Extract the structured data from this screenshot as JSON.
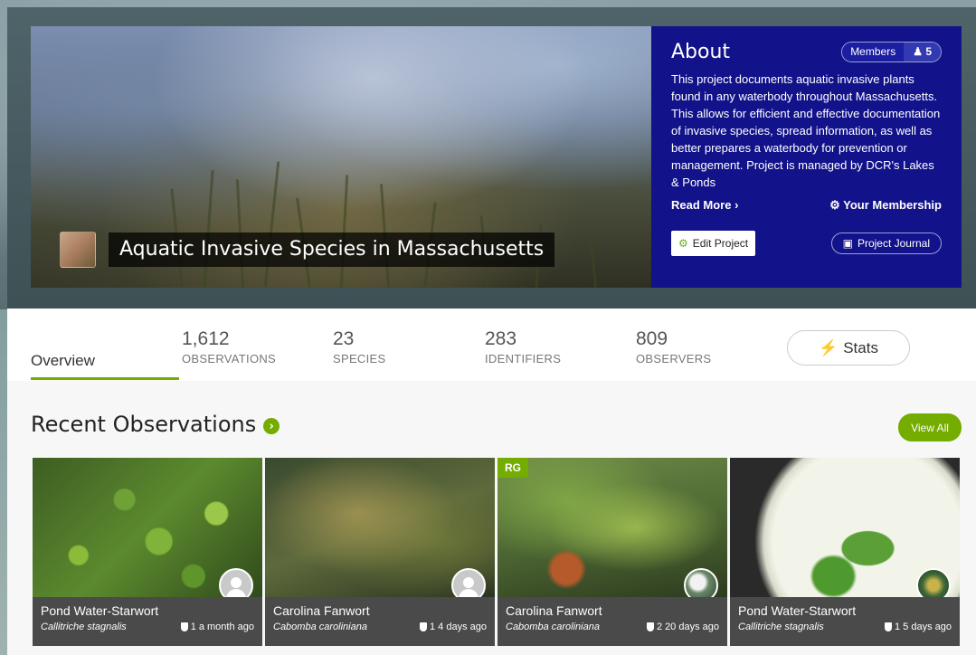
{
  "project": {
    "title": "Aquatic Invasive Species in Massachusetts"
  },
  "about": {
    "heading": "About",
    "members_label": "Members",
    "members_count": "5",
    "description": "This project documents aquatic invasive plants found in any waterbody throughout Massachusetts. This allows for efficient and effective documentation of invasive species, spread information, as well as better prepares a waterbody for prevention or management. Project is managed by DCR's Lakes & Ponds",
    "read_more": "Read More",
    "your_membership": "Your Membership",
    "edit_project": "Edit Project",
    "project_journal": "Project Journal"
  },
  "stats": {
    "overview_tab": "Overview",
    "items": [
      {
        "num": "1,612",
        "label": "OBSERVATIONS"
      },
      {
        "num": "23",
        "label": "SPECIES"
      },
      {
        "num": "283",
        "label": "IDENTIFIERS"
      },
      {
        "num": "809",
        "label": "OBSERVERS"
      }
    ],
    "stats_button": "Stats"
  },
  "recent": {
    "title": "Recent Observations",
    "view_all": "View All",
    "cards": [
      {
        "common": "Pond Water-Starwort",
        "scientific": "Callitriche stagnalis",
        "ids": "1",
        "time": "a month ago",
        "badge": ""
      },
      {
        "common": "Carolina Fanwort",
        "scientific": "Cabomba caroliniana",
        "ids": "1",
        "time": "4 days ago",
        "badge": ""
      },
      {
        "common": "Carolina Fanwort",
        "scientific": "Cabomba caroliniana",
        "ids": "2",
        "time": "20 days ago",
        "badge": "RG"
      },
      {
        "common": "Pond Water-Starwort",
        "scientific": "Callitriche stagnalis",
        "ids": "1",
        "time": "5 days ago",
        "badge": ""
      }
    ]
  },
  "colors": {
    "accent_green": "#74ac00",
    "about_bg": "#12128a"
  }
}
